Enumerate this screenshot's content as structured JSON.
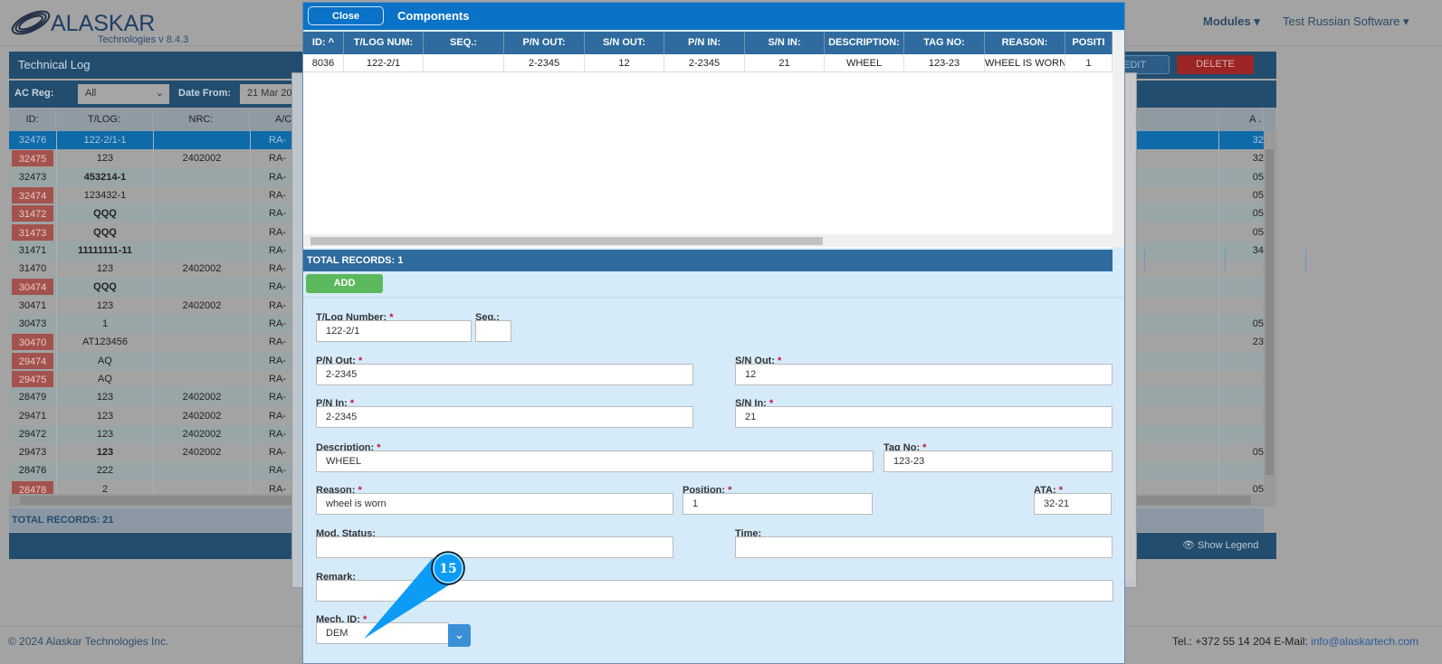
{
  "app": {
    "logo_name": "ALASKAR",
    "logo_sub": "Technologies",
    "version": "v 8.4.3",
    "nav_modules": "Modules ▾",
    "nav_user": "Test Russian Software ▾"
  },
  "panel": {
    "title": "Technical Log",
    "edit_label": "EDIT",
    "delete_label": "DELETE",
    "ac_reg_label": "AC Reg:",
    "ac_reg_value": "All",
    "date_from_label": "Date From:",
    "date_from_value": "21 Mar 20",
    "total": "TOTAL RECORDS: 21",
    "show_legend": "Show Legend",
    "columns": [
      "ID:",
      "T/LOG:",
      "NRC:",
      "A/C",
      "A ."
    ],
    "rows": [
      {
        "id": "32476",
        "tlog": "122-2/1-1",
        "nrc": "",
        "ac": "RA-",
        "a": "32",
        "red": false,
        "sel": true
      },
      {
        "id": "32475",
        "tlog": "123",
        "nrc": "2402002",
        "ac": "RA-",
        "a": "32",
        "red": true
      },
      {
        "id": "32473",
        "tlog": "453214-1",
        "nrc": "",
        "ac": "RA-",
        "a": "05",
        "red": false,
        "bold": true
      },
      {
        "id": "32474",
        "tlog": "123432-1",
        "nrc": "",
        "ac": "RA-",
        "a": "05",
        "red": true
      },
      {
        "id": "31472",
        "tlog": "QQQ",
        "nrc": "",
        "ac": "RA-",
        "a": "05",
        "red": true,
        "bold": true
      },
      {
        "id": "31473",
        "tlog": "QQQ",
        "nrc": "",
        "ac": "RA-",
        "a": "05",
        "red": true,
        "bold": true
      },
      {
        "id": "31471",
        "tlog": "11111111-11",
        "nrc": "",
        "ac": "RA-",
        "a": "34",
        "red": false,
        "bold": true
      },
      {
        "id": "31470",
        "tlog": "123",
        "nrc": "2402002",
        "ac": "RA-",
        "a": "",
        "red": false
      },
      {
        "id": "30474",
        "tlog": "QQQ",
        "nrc": "",
        "ac": "RA-",
        "a": "",
        "red": true,
        "bold": true
      },
      {
        "id": "30471",
        "tlog": "123",
        "nrc": "2402002",
        "ac": "RA-",
        "a": "",
        "red": false
      },
      {
        "id": "30473",
        "tlog": "1",
        "nrc": "",
        "ac": "RA-",
        "a": "05",
        "red": false
      },
      {
        "id": "30470",
        "tlog": "AT123456",
        "nrc": "",
        "ac": "RA-",
        "a": "23",
        "red": true
      },
      {
        "id": "29474",
        "tlog": "AQ",
        "nrc": "",
        "ac": "RA-",
        "a": "",
        "red": true
      },
      {
        "id": "29475",
        "tlog": "AQ",
        "nrc": "",
        "ac": "RA-",
        "a": "",
        "red": true
      },
      {
        "id": "28479",
        "tlog": "123",
        "nrc": "2402002",
        "ac": "RA-",
        "a": "",
        "red": false
      },
      {
        "id": "29471",
        "tlog": "123",
        "nrc": "2402002",
        "ac": "RA-",
        "a": "",
        "red": false
      },
      {
        "id": "29472",
        "tlog": "123",
        "nrc": "2402002",
        "ac": "RA-",
        "a": "",
        "red": false
      },
      {
        "id": "29473",
        "tlog": "123",
        "nrc": "2402002",
        "ac": "RA-",
        "a": "05",
        "red": false,
        "bold": true
      },
      {
        "id": "28476",
        "tlog": "222",
        "nrc": "",
        "ac": "RA-",
        "a": "",
        "red": false
      },
      {
        "id": "28478",
        "tlog": "2",
        "nrc": "",
        "ac": "RA-",
        "a": "05",
        "red": true
      }
    ]
  },
  "modal": {
    "close_label": "Close",
    "title": "Components",
    "columns": [
      "ID: ^",
      "T/LOG NUM:",
      "SEQ.:",
      "P/N OUT:",
      "S/N OUT:",
      "P/N IN:",
      "S/N IN:",
      "DESCRIPTION:",
      "TAG NO:",
      "REASON:",
      "POSITI"
    ],
    "row": [
      "8036",
      "122-2/1",
      "",
      "2-2345",
      "12",
      "2-2345",
      "21",
      "WHEEL",
      "123-23",
      "WHEEL IS WORN",
      "1"
    ],
    "total": "TOTAL RECORDS: 1",
    "add_label": "ADD",
    "form": {
      "tlog": {
        "label": "T/Log Number:",
        "value": "122-2/1"
      },
      "seq": {
        "label": "Seq.:",
        "value": ""
      },
      "pn_out": {
        "label": "P/N Out:",
        "value": "2-2345"
      },
      "sn_out": {
        "label": "S/N Out:",
        "value": "12"
      },
      "pn_in": {
        "label": "P/N In:",
        "value": "2-2345"
      },
      "sn_in": {
        "label": "S/N In:",
        "value": "21"
      },
      "description": {
        "label": "Description:",
        "value": "WHEEL"
      },
      "tag_no": {
        "label": "Tag No:",
        "value": "123-23"
      },
      "reason": {
        "label": "Reason:",
        "value": "wheel is worn"
      },
      "position": {
        "label": "Position:",
        "value": "1"
      },
      "ata": {
        "label": "ATA:",
        "value": "32-21"
      },
      "mod_status": {
        "label": "Mod. Status:",
        "value": ""
      },
      "time": {
        "label": "Time:",
        "value": ""
      },
      "remark": {
        "label": "Remark:",
        "value": ""
      },
      "mech_id": {
        "label": "Mech. ID:",
        "value": "DEM"
      }
    }
  },
  "annotation": {
    "number": "15",
    "color": "#0d9cf5"
  },
  "footer": {
    "copyright": "© 2024 Alaskar Technologies Inc.",
    "contact": "Tel.: +372 55 14 204 E-Mail: ",
    "email": "info@alaskartech.com"
  }
}
